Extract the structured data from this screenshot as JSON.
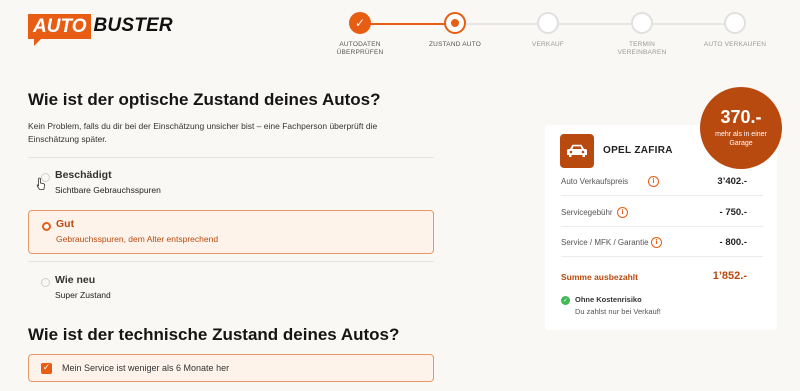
{
  "header": {
    "logo_highlight": "AUTO",
    "logo_text": "BUSTER",
    "steps": [
      {
        "label_line1": "AUTODATEN",
        "label_line2": "ÜBERPRÜFEN",
        "state": "done"
      },
      {
        "label_line1": "ZUSTAND AUTO",
        "label_line2": "",
        "state": "current"
      },
      {
        "label_line1": "VERKAUF",
        "label_line2": "",
        "state": "pending"
      },
      {
        "label_line1": "TERMIN",
        "label_line2": "VEREINBAREN",
        "state": "pending"
      },
      {
        "label_line1": "AUTO VERKAUFEN",
        "label_line2": "",
        "state": "pending"
      }
    ],
    "check_glyph": "✓"
  },
  "optical": {
    "title": "Wie ist der optische Zustand deines Autos?",
    "subtitle": "Kein Problem, falls du dir bei der Einschätzung unsicher bist – eine Fachperson überprüft die Einschätzung später.",
    "options": [
      {
        "title": "Beschädigt",
        "desc": "Sichtbare Gebrauchsspuren",
        "selected": false
      },
      {
        "title": "Gut",
        "desc": "Gebrauchsspuren, dem Alter entsprechend",
        "selected": true
      },
      {
        "title": "Wie neu",
        "desc": "Super Zustand",
        "selected": false
      }
    ]
  },
  "technical": {
    "title": "Wie ist der technische Zustand deines Autos?",
    "checkbox_label": "Mein Service ist weniger als 6 Monate her",
    "checkbox_checked": true,
    "check_glyph": "✓"
  },
  "summary": {
    "car_name": "OPEL ZAFIRA",
    "rows": [
      {
        "label": "Auto Verkaufspreis",
        "value": "3’402.-"
      },
      {
        "label": "Servicegebühr",
        "value": "- 750.-"
      },
      {
        "label": "Service / MFK / Garantie",
        "value": "- 800.-"
      }
    ],
    "info_glyph": "i",
    "total_label": "Summe ausbezahlt",
    "total_value": "1’852.-",
    "risk_title": "Ohne Kostenrisiko",
    "risk_sub": "Du zahlst nur bei Verkauf!",
    "risk_glyph": "✓"
  },
  "badge": {
    "amount": "370.-",
    "text": "mehr als in einer Garage"
  },
  "colors": {
    "accent": "#e85d14",
    "accent_dark": "#b84a10",
    "success": "#3cba54",
    "background": "#faf8f4"
  },
  "icons": [
    "check-icon",
    "car-icon",
    "info-icon",
    "radio-icon",
    "cursor-icon"
  ]
}
